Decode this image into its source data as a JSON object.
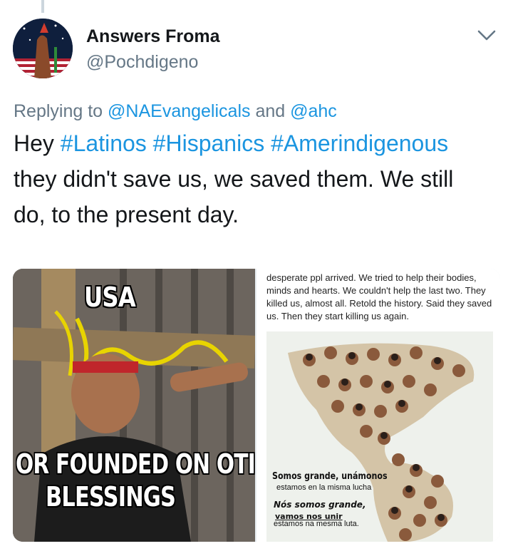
{
  "tweet": {
    "display_name": "Answers Froma",
    "handle": "@Pochdigeno",
    "reply": {
      "prefix": "Replying to",
      "mention1": "@NAEvangelicals",
      "conjunction": "and",
      "mention2": "@ahc"
    },
    "text": {
      "word_hey": "Hey",
      "hashtag1": "#Latinos",
      "hashtag2": "#Hispanics",
      "hashtag3": "#Amerindigenous",
      "line2": "they didn't save us, we saved them. We still",
      "line3": "do, to the present day."
    },
    "icons": {
      "options": "chevron-down-icon",
      "avatar": "user-avatar"
    },
    "colors": {
      "link": "#1b95e0",
      "secondary": "#657786",
      "text": "#14171a"
    }
  },
  "media": {
    "left_image": {
      "top_text": "USA",
      "bottom_line1": "OR FOUNDED ON OTI",
      "bottom_line2": "BLESSINGS"
    },
    "right_image": {
      "caption": "desperate ppl arrived. We tried to help their bodies, minds and hearts. We couldn't help the last two. They killed us, almost all. Retold the history. Said they saved us. Then they start killing us again.",
      "map_text1": "Somos grande, unámonos",
      "map_text2": "estamos en la misma lucha",
      "map_text3": "Nós somos grande,",
      "map_text4": "vamos nos unir",
      "map_text5": "estamos na mesma luta."
    }
  }
}
